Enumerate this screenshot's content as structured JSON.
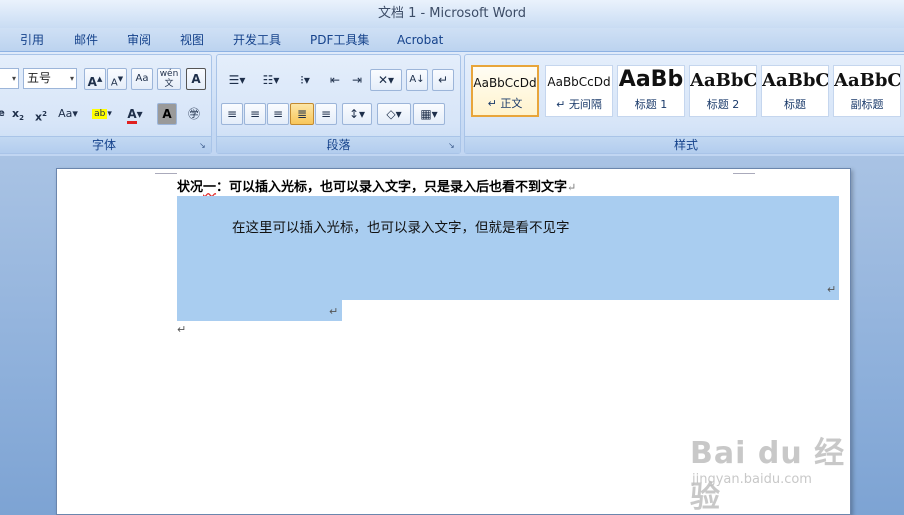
{
  "window": {
    "title": "文档 1 - Microsoft Word"
  },
  "tabs": [
    {
      "label": "引用"
    },
    {
      "label": "邮件"
    },
    {
      "label": "审阅"
    },
    {
      "label": "视图"
    },
    {
      "label": "开发工具"
    },
    {
      "label": "PDF工具集"
    },
    {
      "label": "Acrobat"
    }
  ],
  "ribbon": {
    "font_group": {
      "label": "字体",
      "font_size": "五号"
    },
    "paragraph_group": {
      "label": "段落"
    },
    "styles_group": {
      "label": "样式",
      "styles": [
        {
          "preview": "AaBbCcDd",
          "name": "↵ 正文",
          "selected": true
        },
        {
          "preview": "AaBbCcDd",
          "name": "↵ 无间隔",
          "selected": false
        },
        {
          "preview": "AaBb",
          "name": "标题 1",
          "selected": false
        },
        {
          "preview": "AaBbC",
          "name": "标题 2",
          "selected": false
        },
        {
          "preview": "AaBbC",
          "name": "标题",
          "selected": false
        },
        {
          "preview": "AaBbC",
          "name": "副标题",
          "selected": false
        }
      ]
    }
  },
  "document": {
    "heading_part1": "状况",
    "heading_part2": "一",
    "heading_part3": "：可以插入光标，也可以录入文字，只是录入后也看不到文字",
    "paragraph_mark": "↵",
    "shaded_text": "在这里可以插入光标，也可以录入文字，但就是看不见字"
  },
  "watermark": {
    "logo": "Bai du 经验",
    "url": "jingyan.baidu.com"
  }
}
